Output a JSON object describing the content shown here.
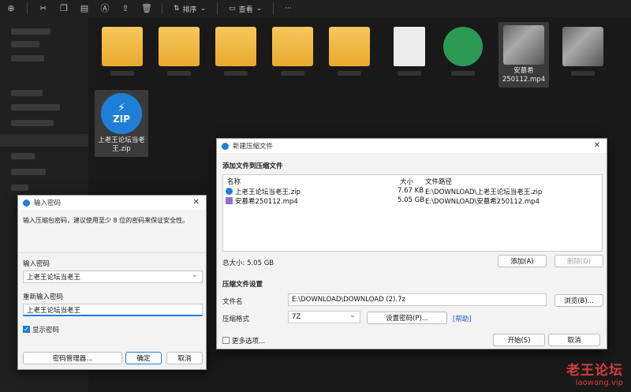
{
  "toolbar": {
    "sort_label": "排序",
    "view_label": "查看",
    "more_label": "···"
  },
  "files": [
    {
      "name": "安慕希250112.mp4"
    },
    {
      "name": "上老王论坛当老王.zip"
    }
  ],
  "compress_dialog": {
    "title": "新建压缩文件",
    "add_section": "添加文件到压缩文件",
    "columns": {
      "name": "名称",
      "size": "大小",
      "path": "文件路径"
    },
    "rows": [
      {
        "name": "上老王论坛当老王.zip",
        "size": "7.67 KB",
        "path": "E:\\DOWNLOAD\\上老王论坛当老王.zip"
      },
      {
        "name": "安慕希250112.mp4",
        "size": "5.05 GB",
        "path": "E:\\DOWNLOAD\\安慕希250112.mp4"
      }
    ],
    "total": "总大小: 5.05 GB",
    "add_button": "添加(A)",
    "remove_button": "删除(D)",
    "settings_section": "压缩文件设置",
    "filename_label": "文件名",
    "filename_value": "E:\\DOWNLOAD\\DOWNLOAD (2).7z",
    "browse_button": "浏览(B)...",
    "format_label": "压缩格式",
    "format_value": "7Z",
    "set_password_button": "设置密码(P)...",
    "help_link": "[帮助]",
    "more_options": "更多选项...",
    "start_button": "开始(S)",
    "cancel_button": "取消"
  },
  "password_dialog": {
    "title": "输入密码",
    "hint": "输入压缩包密码，建议使用至少 8 位的密码来保证安全性。",
    "password_label": "输入密码",
    "password_value": "上老王论坛当老王",
    "repeat_label": "重新输入密码",
    "repeat_value": "上老王论坛当老王",
    "show_password": "显示密码",
    "manager_button": "密码管理器...",
    "ok_button": "确定",
    "cancel_button": "取消"
  },
  "watermark": {
    "title": "老王论坛",
    "url": "laowang.vip"
  },
  "colors": {
    "accent": "#1f7fd6",
    "folder": "#f2bd4a",
    "watermark": "#d43c3c"
  }
}
